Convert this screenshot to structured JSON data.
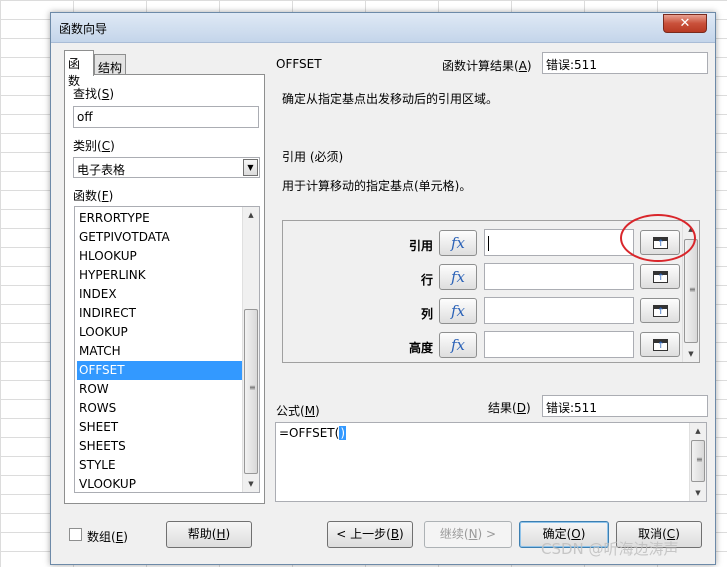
{
  "dialog": {
    "title": "函数向导",
    "close_glyph": "✕"
  },
  "tabs": [
    {
      "label": "函数",
      "active": true
    },
    {
      "label": "结构",
      "active": false
    }
  ],
  "search": {
    "label": "查找(S)",
    "label_main": "查找(",
    "label_key": "S",
    "label_end": ")",
    "value": "off"
  },
  "category": {
    "label_main": "类别(",
    "label_key": "C",
    "label_end": ")",
    "selected": "电子表格"
  },
  "functions": {
    "label_main": "函数(",
    "label_key": "F",
    "label_end": ")",
    "items": [
      "ERRORTYPE",
      "GETPIVOTDATA",
      "HLOOKUP",
      "HYPERLINK",
      "INDEX",
      "INDIRECT",
      "LOOKUP",
      "MATCH",
      "OFFSET",
      "ROW",
      "ROWS",
      "SHEET",
      "SHEETS",
      "STYLE",
      "VLOOKUP"
    ],
    "selected": "OFFSET"
  },
  "function_info": {
    "name": "OFFSET",
    "result_label_main": "函数计算结果(",
    "result_label_key": "A",
    "result_label_end": ")",
    "result_value": "错误:511",
    "description": "确定从指定基点出发移动后的引用区域。",
    "param_heading": "引用 (必须)",
    "param_description": "用于计算移动的指定基点(单元格)。"
  },
  "arguments": [
    {
      "label": "引用",
      "value": ""
    },
    {
      "label": "行",
      "value": ""
    },
    {
      "label": "列",
      "value": ""
    },
    {
      "label": "高度",
      "value": ""
    }
  ],
  "fx_glyph": "fx",
  "formula": {
    "label_main": "公式(",
    "label_key": "M",
    "label_end": ")",
    "value_before": "=OFFSET(",
    "value_cursor": ")",
    "result_label_main": "结果(",
    "result_label_key": "D",
    "result_label_end": ")",
    "result_value": "错误:511"
  },
  "array_checkbox": {
    "label_main": "数组(",
    "label_key": "E",
    "label_end": ")",
    "checked": false
  },
  "buttons": {
    "help": {
      "main": "帮助(",
      "key": "H",
      "end": ")"
    },
    "back": {
      "main": "< 上一步(",
      "key": "B",
      "end": ")"
    },
    "next": {
      "main": "继续(",
      "key": "N",
      "end": ") >"
    },
    "ok": {
      "main": "确定(",
      "key": "O",
      "end": ")"
    },
    "cancel": {
      "main": "取消(",
      "key": "C",
      "end": ")"
    }
  },
  "watermark": "CSDN @听海边涛声",
  "colors": {
    "selection": "#3399ff",
    "fx_blue": "#2b62b7",
    "annotation_red": "#d9262b"
  }
}
